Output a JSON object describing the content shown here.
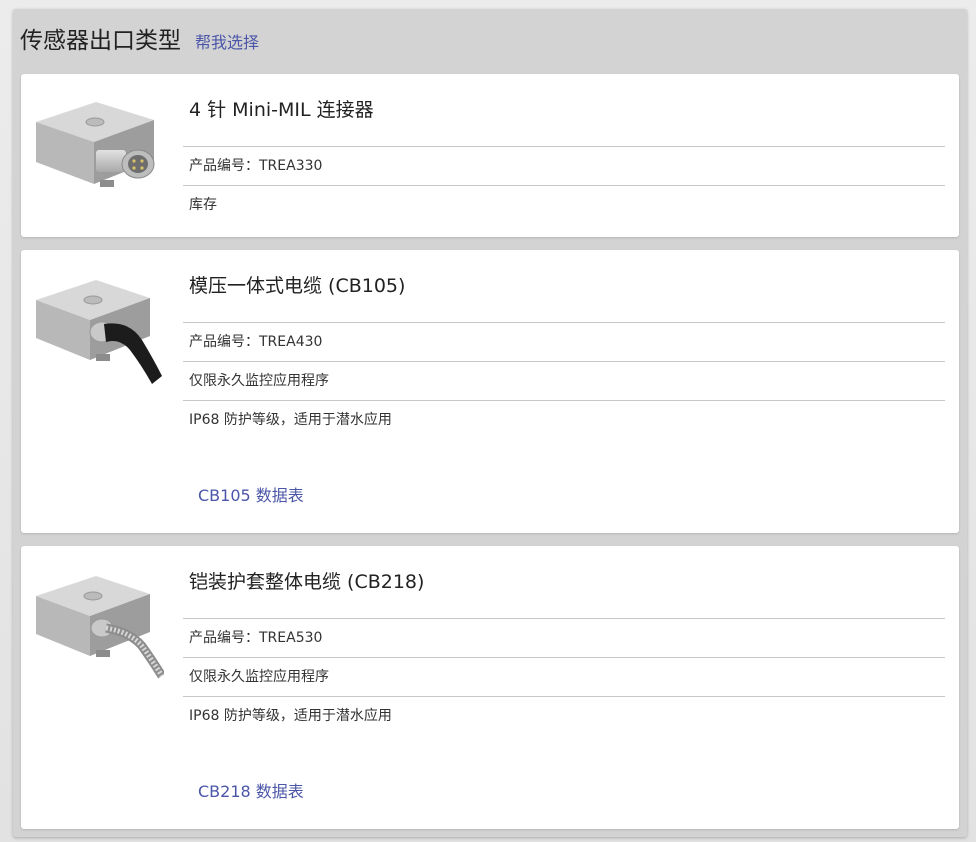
{
  "header": {
    "title": "传感器出口类型",
    "help_link": "帮我选择"
  },
  "cards": [
    {
      "title": "4 针 Mini-MIL 连接器",
      "rows": [
        "产品编号：TREA330",
        "库存"
      ],
      "image_icon": "connector-sensor-icon"
    },
    {
      "title": "模压一体式电缆 (CB105)",
      "rows": [
        "产品编号：TREA430",
        "仅限永久监控应用程序",
        "IP68 防护等级，适用于潜水应用"
      ],
      "link": "CB105 数据表",
      "image_icon": "molded-cable-sensor-icon"
    },
    {
      "title": "铠装护套整体电缆 (CB218)",
      "rows": [
        "产品编号：TREA530",
        "仅限永久监控应用程序",
        "IP68 防护等级，适用于潜水应用"
      ],
      "link": "CB218 数据表",
      "image_icon": "armored-cable-sensor-icon"
    }
  ],
  "colors": {
    "link": "#4b56a8",
    "panel": "#d3d3d3",
    "card": "#ffffff"
  }
}
